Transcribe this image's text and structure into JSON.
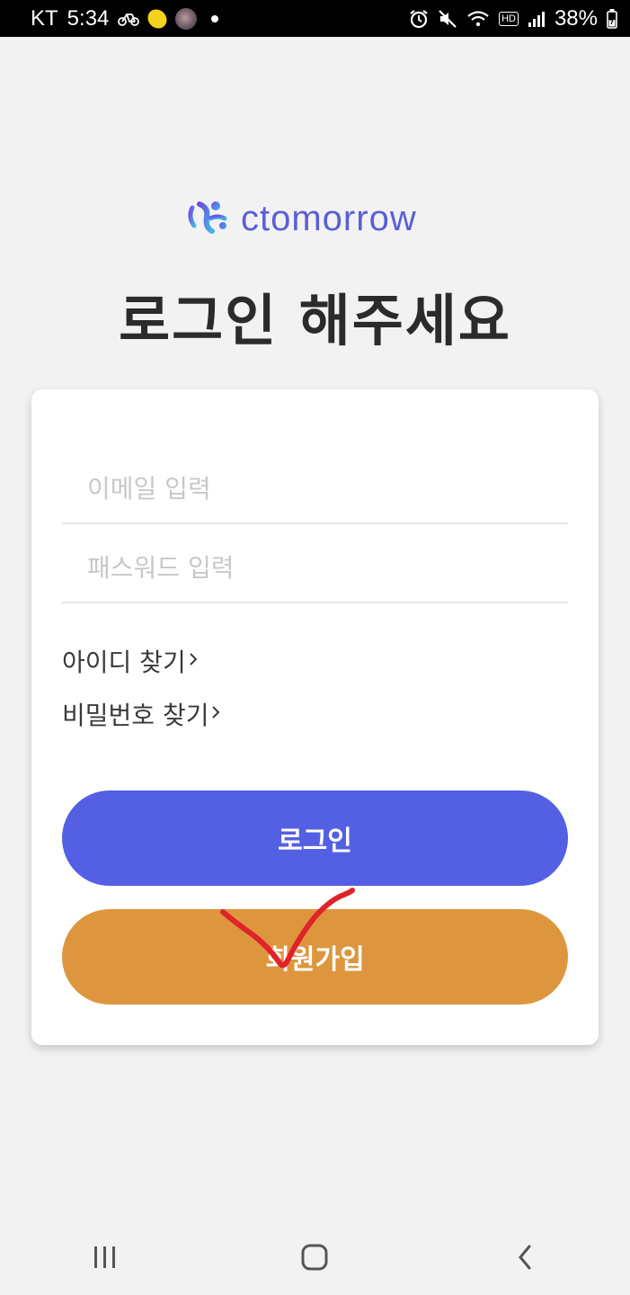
{
  "status_bar": {
    "carrier": "KT",
    "time": "5:34",
    "battery": "38%"
  },
  "logo": {
    "text": "ctomorrow",
    "brand_color": "#5a5fd6"
  },
  "heading": "로그인 해주세요",
  "form": {
    "email_placeholder": "이메일 입력",
    "email_value": "",
    "password_placeholder": "패스워드 입력",
    "password_value": ""
  },
  "links": {
    "find_id": "아이디 찾기",
    "find_password": "비밀번호 찾기"
  },
  "buttons": {
    "login": "로그인",
    "signup": "회원가입",
    "login_color": "#5460e3",
    "signup_color": "#de963e"
  },
  "annotation": {
    "mark": "red-checkmark",
    "color": "#e0222a"
  },
  "icons": {
    "status_left": [
      "bicycle-icon",
      "lemon-icon",
      "avatar-icon",
      "dot-icon"
    ],
    "status_right": [
      "alarm-icon",
      "mute-icon",
      "wifi-icon",
      "hd-icon",
      "signal-icon",
      "battery-icon"
    ],
    "nav": [
      "recent-apps-icon",
      "home-icon",
      "back-icon"
    ]
  }
}
